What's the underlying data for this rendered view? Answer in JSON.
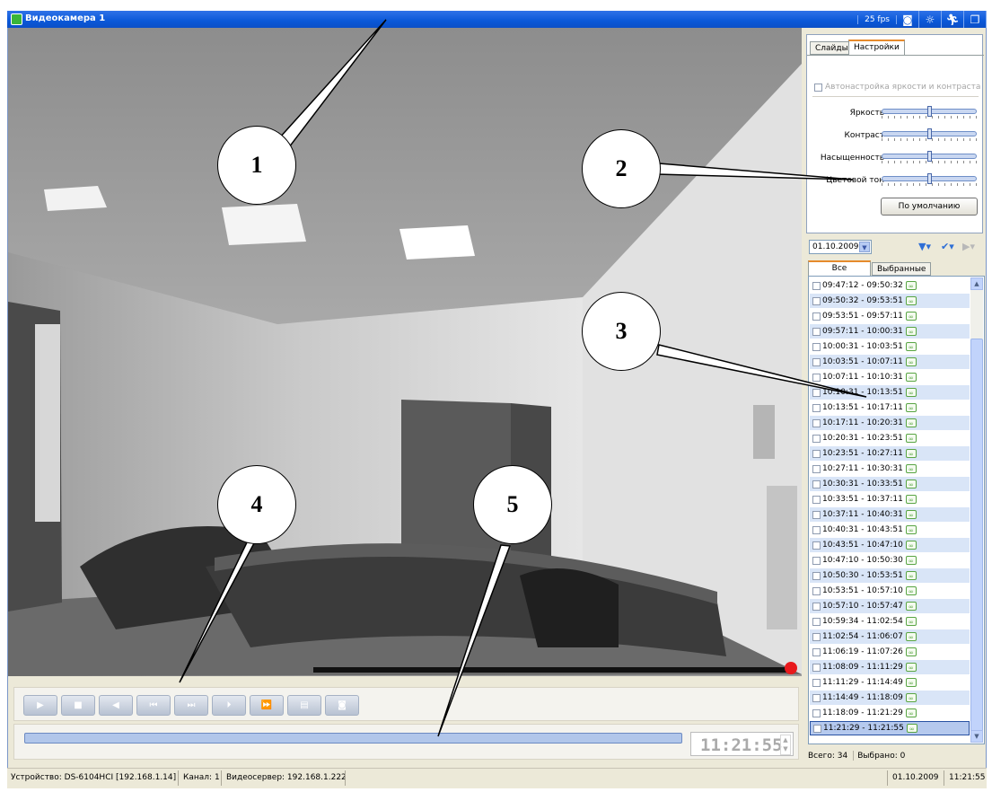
{
  "window": {
    "title": "Видеокамера 1",
    "fps": "25 fps",
    "toolbar_icons": [
      "snapshot-icon",
      "brightness-icon",
      "motion-icon",
      "restore-window-icon"
    ]
  },
  "settings_panel": {
    "tabs": [
      "Слайды",
      "Настройки"
    ],
    "active_tab": "Настройки",
    "auto_adjust_label": "Автонастройка яркости и контраста",
    "sliders": [
      {
        "label": "Яркость",
        "value": 0.5
      },
      {
        "label": "Контраст",
        "value": 0.5
      },
      {
        "label": "Насыщенность",
        "value": 0.5
      },
      {
        "label": "Цветовой тон",
        "value": 0.5
      }
    ],
    "default_button": "По умолчанию"
  },
  "recordings": {
    "date": "01.10.2009",
    "tabs": [
      "Все",
      "Выбранные"
    ],
    "active_tab": "Все",
    "intervals": [
      "09:47:12 - 09:50:32",
      "09:50:32 - 09:53:51",
      "09:53:51 - 09:57:11",
      "09:57:11 - 10:00:31",
      "10:00:31 - 10:03:51",
      "10:03:51 - 10:07:11",
      "10:07:11 - 10:10:31",
      "10:10:31 - 10:13:51",
      "10:13:51 - 10:17:11",
      "10:17:11 - 10:20:31",
      "10:20:31 - 10:23:51",
      "10:23:51 - 10:27:11",
      "10:27:11 - 10:30:31",
      "10:30:31 - 10:33:51",
      "10:33:51 - 10:37:11",
      "10:37:11 - 10:40:31",
      "10:40:31 - 10:43:51",
      "10:43:51 - 10:47:10",
      "10:47:10 - 10:50:30",
      "10:50:30 - 10:53:51",
      "10:53:51 - 10:57:10",
      "10:57:10 - 10:57:47",
      "10:59:34 - 11:02:54",
      "11:02:54 - 11:06:07",
      "11:06:19 - 11:07:26",
      "11:08:09 - 11:11:29",
      "11:11:29 - 11:14:49",
      "11:14:49 - 11:18:09",
      "11:18:09 - 11:21:29",
      "11:21:29 - 11:21:55"
    ],
    "selected_index": 29,
    "badge_symbol": "∞",
    "total_label": "Всего: 34",
    "selected_label": "Выбрано: 0"
  },
  "player": {
    "buttons": [
      {
        "name": "play-button",
        "symbol": "▶"
      },
      {
        "name": "stop-button",
        "symbol": "■"
      },
      {
        "name": "reverse-button",
        "symbol": "◀"
      },
      {
        "name": "prev-frame-button",
        "symbol": "⏮"
      },
      {
        "name": "next-frame-button",
        "symbol": "⏭"
      },
      {
        "name": "step-button",
        "symbol": "⏵"
      },
      {
        "name": "fast-forward-button",
        "symbol": "⏩"
      },
      {
        "name": "save-button",
        "symbol": "▤"
      },
      {
        "name": "camera-button",
        "symbol": "◙"
      }
    ],
    "time": "11:21:55"
  },
  "status_bar": {
    "device": "Устройство: DS-6104HCI [192.168.1.14]",
    "channel": "Канал: 1",
    "server": "Видеосервер: 192.168.1.222",
    "date": "01.10.2009",
    "time": "11:21:55"
  },
  "callouts": [
    "1",
    "2",
    "3",
    "4",
    "5"
  ],
  "colors": {
    "title_bar": "#0A58D8",
    "row_alt": "#D9E5F7",
    "record_indicator": "#E8191C"
  }
}
